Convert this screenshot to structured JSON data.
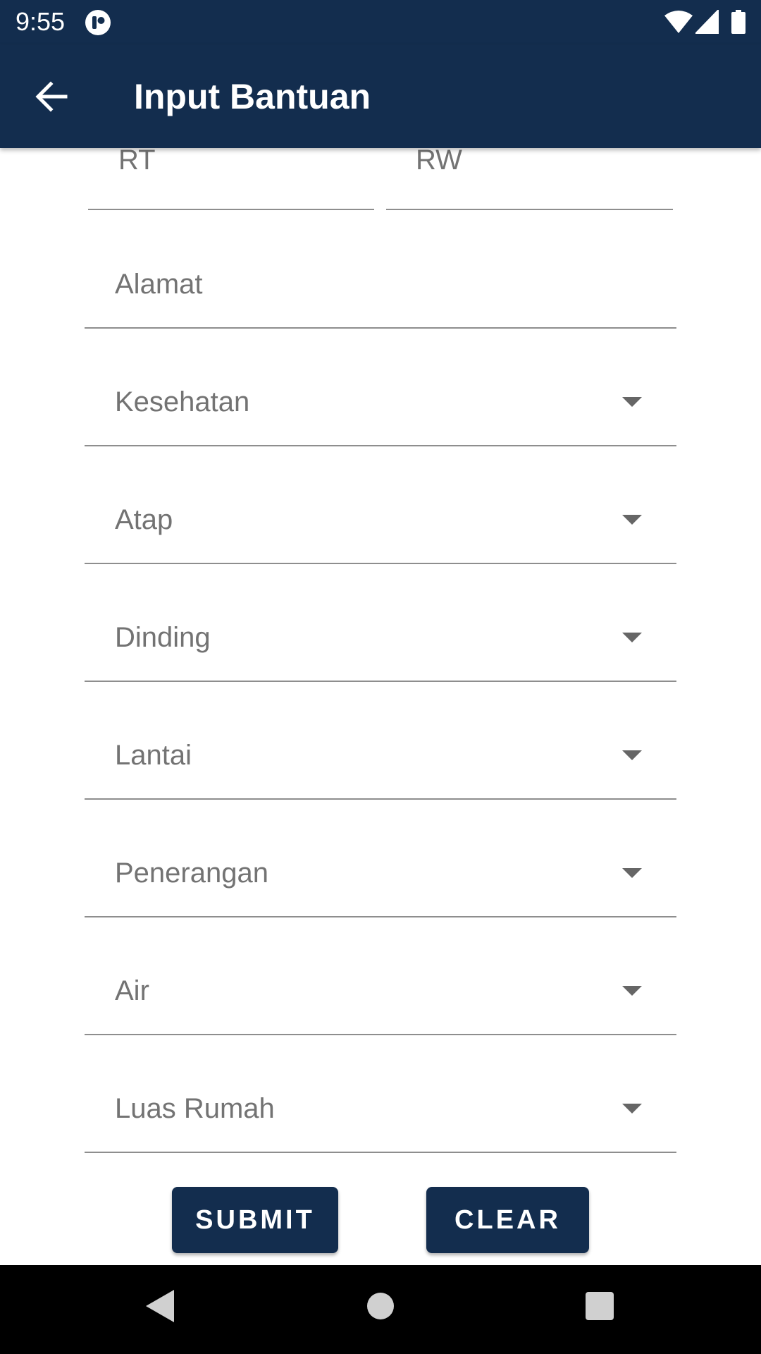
{
  "status_bar": {
    "time": "9:55",
    "icons": [
      "app-notification-icon",
      "wifi-icon",
      "signal-icon",
      "battery-icon"
    ]
  },
  "app_bar": {
    "title": "Input Bantuan",
    "back_icon": "arrow-left-icon",
    "background_color": "#132d4e"
  },
  "form": {
    "rt_placeholder": "RT",
    "rw_placeholder": "RW",
    "alamat_placeholder": "Alamat",
    "dropdowns": {
      "kesehatan": "Kesehatan",
      "atap": "Atap",
      "dinding": "Dinding",
      "lantai": "Lantai",
      "penerangan": "Penerangan",
      "air": "Air",
      "luas_rumah": "Luas Rumah"
    }
  },
  "buttons": {
    "submit": "SUBMIT",
    "clear": "CLEAR",
    "color": "#132d4e"
  },
  "nav_bar": {
    "icons": [
      "nav-back-icon",
      "nav-home-icon",
      "nav-recents-icon"
    ]
  }
}
